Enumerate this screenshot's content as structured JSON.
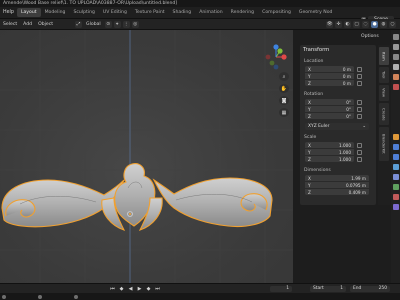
{
  "titlebar": {
    "title": "Amende\\Wood Base relief\\1. TO UPLOAD\\A03887-OR\\Upload\\untitled.blend]"
  },
  "menubar": {
    "help": "Help",
    "workspaces": [
      "Layout",
      "Modeling",
      "Sculpting",
      "UV Editing",
      "Texture Paint",
      "Shading",
      "Animation",
      "Rendering",
      "Compositing",
      "Geometry Nod"
    ],
    "scene_label": "Scene"
  },
  "header": {
    "menus": [
      "Select",
      "Add",
      "Object"
    ],
    "transform_orientation": "Global",
    "options_label": "Options"
  },
  "npanel": {
    "title": "Transform",
    "location": {
      "label": "Location",
      "x": "0 m",
      "y": "0 m",
      "z": "0 m"
    },
    "rotation": {
      "label": "Rotation",
      "x": "0°",
      "y": "0°",
      "z": "0°"
    },
    "rotation_mode": "XYZ Euler",
    "scale": {
      "label": "Scale",
      "x": "1.000",
      "y": "1.000",
      "z": "1.000"
    },
    "dimensions": {
      "label": "Dimensions",
      "x": "1.99 m",
      "y": "0.0795 m",
      "z": "0.409 m"
    },
    "axis_labels": [
      "X",
      "Y",
      "Z"
    ]
  },
  "side_tabs": [
    "Item",
    "Tool",
    "View",
    "Create",
    "BlenderKit"
  ],
  "timeline": {
    "frame_current": "1",
    "start_label": "Start",
    "start_value": "1",
    "end_label": "End",
    "end_value": "250"
  },
  "colors": {
    "selection_outline": "#f0a030",
    "active_workspace": "#3d3d3d",
    "gizmo_x": "#e04848",
    "gizmo_y": "#7fbf3a",
    "gizmo_z": "#3e83e0"
  }
}
